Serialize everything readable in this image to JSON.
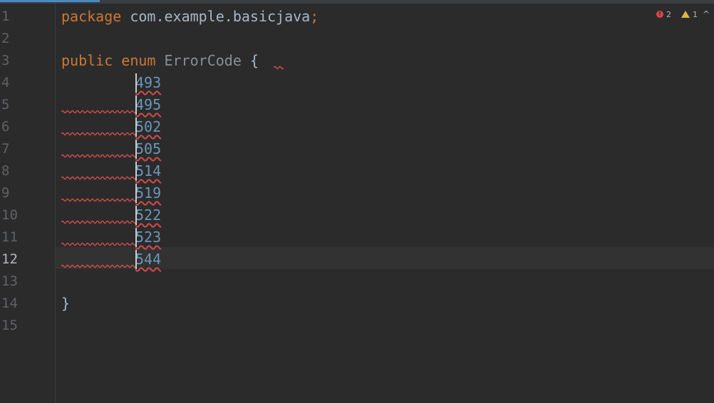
{
  "editor": {
    "line_numbers": [
      "1",
      "2",
      "3",
      "4",
      "5",
      "6",
      "7",
      "8",
      "9",
      "10",
      "11",
      "12",
      "13",
      "14",
      "15"
    ],
    "current_line": "12",
    "code": {
      "line1_keyword": "package",
      "line1_package": " com.example.basicjava",
      "line1_semicolon": ";",
      "line3_public": "public",
      "line3_enum": "enum",
      "line3_type": "ErrorCode",
      "line3_brace": "{",
      "constants": [
        "493",
        "495",
        "502",
        "505",
        "514",
        "519",
        "522",
        "523",
        "544"
      ],
      "closing_brace": "}"
    }
  },
  "inspection": {
    "errors": "2",
    "warnings": "1",
    "error_icon": "error-circle-icon",
    "warning_icon": "warning-triangle-icon",
    "expand_icon": "chevron-up-icon"
  },
  "colors": {
    "background": "#2b2b2b",
    "keyword": "#cc7832",
    "number": "#6897bb",
    "error_underline": "#cf4c4c"
  }
}
